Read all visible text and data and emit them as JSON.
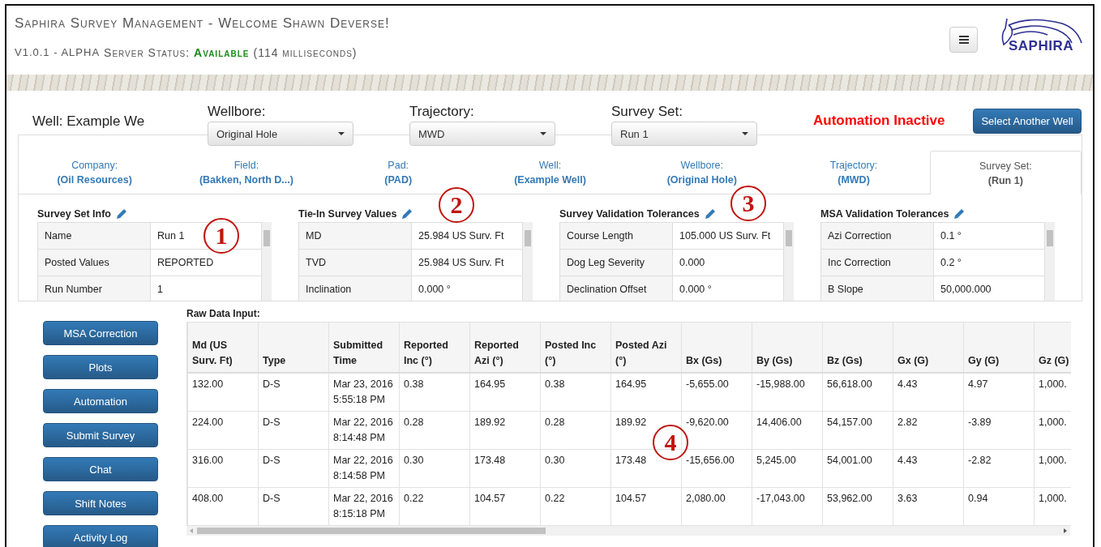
{
  "header": {
    "title": "Saphira Survey Management - Welcome Shawn Deverse!",
    "version": "V1.0.1 - ALPHA",
    "status_label": "Server Status:",
    "status": "Available",
    "latency": "(114 milliseconds)",
    "logo": "SAPHIRA"
  },
  "well_bar": {
    "well": "Well: Example We",
    "selectors": [
      {
        "label": "Wellbore:",
        "value": "Original Hole"
      },
      {
        "label": "Trajectory:",
        "value": "MWD"
      },
      {
        "label": "Survey Set:",
        "value": "Run 1"
      }
    ],
    "automation": "Automation Inactive",
    "select_button": "Select Another Well"
  },
  "tabs": [
    {
      "label": "Company:",
      "value": "(Oil Resources)",
      "selected": false
    },
    {
      "label": "Field:",
      "value": "(Bakken, North D...)",
      "selected": false
    },
    {
      "label": "Pad:",
      "value": "(PAD)",
      "selected": false
    },
    {
      "label": "Well:",
      "value": "(Example Well)",
      "selected": false
    },
    {
      "label": "Wellbore:",
      "value": "(Original Hole)",
      "selected": false
    },
    {
      "label": "Trajectory:",
      "value": "(MWD)",
      "selected": false
    },
    {
      "label": "Survey Set:",
      "value": "(Run 1)",
      "selected": true
    }
  ],
  "panels": [
    {
      "title": "Survey Set Info",
      "rows": [
        [
          "Name",
          "Run 1"
        ],
        [
          "Posted Values",
          "REPORTED"
        ],
        [
          "Run Number",
          "1"
        ]
      ]
    },
    {
      "title": "Tie-In Survey Values",
      "rows": [
        [
          "MD",
          "25.984 US Surv. Ft"
        ],
        [
          "TVD",
          "25.984 US Surv. Ft"
        ],
        [
          "Inclination",
          "0.000 °"
        ]
      ]
    },
    {
      "title": "Survey Validation Tolerances",
      "rows": [
        [
          "Course Length",
          "105.000 US Surv. Ft"
        ],
        [
          "Dog Leg Severity",
          "0.000"
        ],
        [
          "Declination Offset",
          "0.000 °"
        ]
      ]
    },
    {
      "title": "MSA Validation Tolerances",
      "rows": [
        [
          "Azi Correction",
          "0.1 °"
        ],
        [
          "Inc Correction",
          "0.2 °"
        ],
        [
          "B Slope",
          "50,000.000"
        ]
      ]
    }
  ],
  "side_buttons": [
    "MSA Correction",
    "Plots",
    "Automation",
    "Submit Survey",
    "Chat",
    "Shift Notes",
    "Activity Log"
  ],
  "raw_data": {
    "title": "Raw Data Input:",
    "columns": [
      "Md (US Surv. Ft)",
      "Type",
      "Submitted Time",
      "Reported Inc (°)",
      "Reported Azi (°)",
      "Posted Inc (°)",
      "Posted Azi (°)",
      "Bx (Gs)",
      "By (Gs)",
      "Bz (Gs)",
      "Gx (G)",
      "Gy (G)",
      "Gz (G)"
    ],
    "rows": [
      [
        "132.00",
        "D-S",
        "Mar 23, 2016 5:55:18 PM",
        "0.38",
        "164.95",
        "0.38",
        "164.95",
        "-5,655.00",
        "-15,988.00",
        "56,618.00",
        "4.43",
        "4.97",
        "1,000."
      ],
      [
        "224.00",
        "D-S",
        "Mar 22, 2016 8:14:48 PM",
        "0.28",
        "189.92",
        "0.28",
        "189.92",
        "-9,620.00",
        "14,406.00",
        "54,157.00",
        "2.82",
        "-3.89",
        "1,000."
      ],
      [
        "316.00",
        "D-S",
        "Mar 22, 2016 8:14:58 PM",
        "0.30",
        "173.48",
        "0.30",
        "173.48",
        "-15,656.00",
        "5,245.00",
        "54,001.00",
        "4.43",
        "-2.82",
        "1,000."
      ],
      [
        "408.00",
        "D-S",
        "Mar 22, 2016 8:15:18 PM",
        "0.22",
        "104.57",
        "0.22",
        "104.57",
        "2,080.00",
        "-17,043.00",
        "53,962.00",
        "3.63",
        "0.94",
        "1,000."
      ]
    ]
  },
  "callouts": [
    "1",
    "2",
    "3",
    "4"
  ]
}
